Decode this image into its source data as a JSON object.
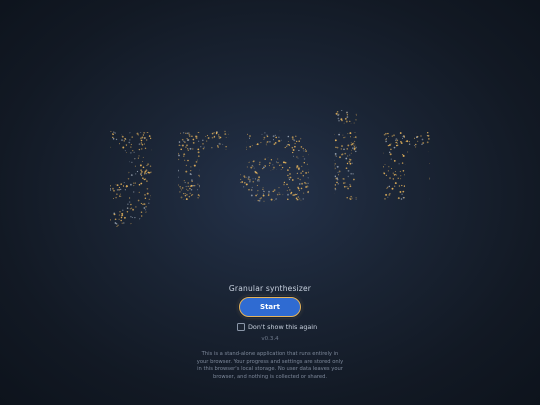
{
  "app": {
    "logo_text": "grain",
    "subtitle": "Granular synthesizer",
    "start_label": "Start",
    "dont_show_label": "Don't show this again",
    "dont_show_checked": false,
    "version": "v0.3.4",
    "disclaimer": "This is a stand-alone application that runs entirely in your browser. Your progress and settings are stored only in this browser's local storage. No user data leaves your browser, and nothing is collected or shared."
  },
  "colors": {
    "background": "#1a2434",
    "speckle_gold": "#e6b45c",
    "speckle_gray": "#9aa4b2",
    "button": "#2f6bd2",
    "button_outline": "#e4b35b"
  }
}
